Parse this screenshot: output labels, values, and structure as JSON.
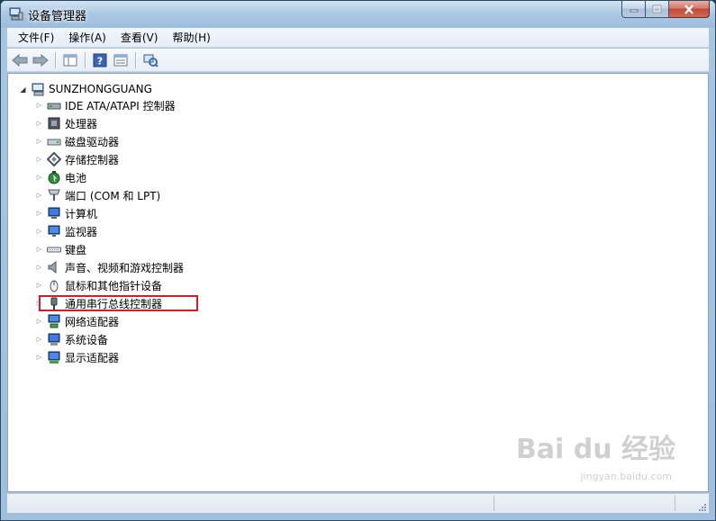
{
  "window": {
    "title": "设备管理器"
  },
  "menu": [
    {
      "label": "文件(F)"
    },
    {
      "label": "操作(A)"
    },
    {
      "label": "查看(V)"
    },
    {
      "label": "帮助(H)"
    }
  ],
  "tree": {
    "root": "SUNZHONGGUANG",
    "items": [
      {
        "label": "IDE ATA/ATAPI 控制器",
        "icon": "ide-controller-icon"
      },
      {
        "label": "处理器",
        "icon": "processor-icon"
      },
      {
        "label": "磁盘驱动器",
        "icon": "disk-drive-icon"
      },
      {
        "label": "存储控制器",
        "icon": "storage-controller-icon"
      },
      {
        "label": "电池",
        "icon": "battery-icon"
      },
      {
        "label": "端口 (COM 和 LPT)",
        "icon": "port-icon"
      },
      {
        "label": "计算机",
        "icon": "computer-icon"
      },
      {
        "label": "监视器",
        "icon": "monitor-icon"
      },
      {
        "label": "键盘",
        "icon": "keyboard-icon"
      },
      {
        "label": "声音、视频和游戏控制器",
        "icon": "sound-icon"
      },
      {
        "label": "鼠标和其他指针设备",
        "icon": "mouse-icon"
      },
      {
        "label": "通用串行总线控制器",
        "icon": "usb-icon"
      },
      {
        "label": "网络适配器",
        "icon": "network-icon"
      },
      {
        "label": "系统设备",
        "icon": "system-devices-icon"
      },
      {
        "label": "显示适配器",
        "icon": "display-adapter-icon"
      }
    ]
  },
  "watermark": {
    "brand": "Bai du 经验",
    "url": "jingyan.baidu.com"
  },
  "colors": {
    "highlight": "#d21f2a"
  }
}
